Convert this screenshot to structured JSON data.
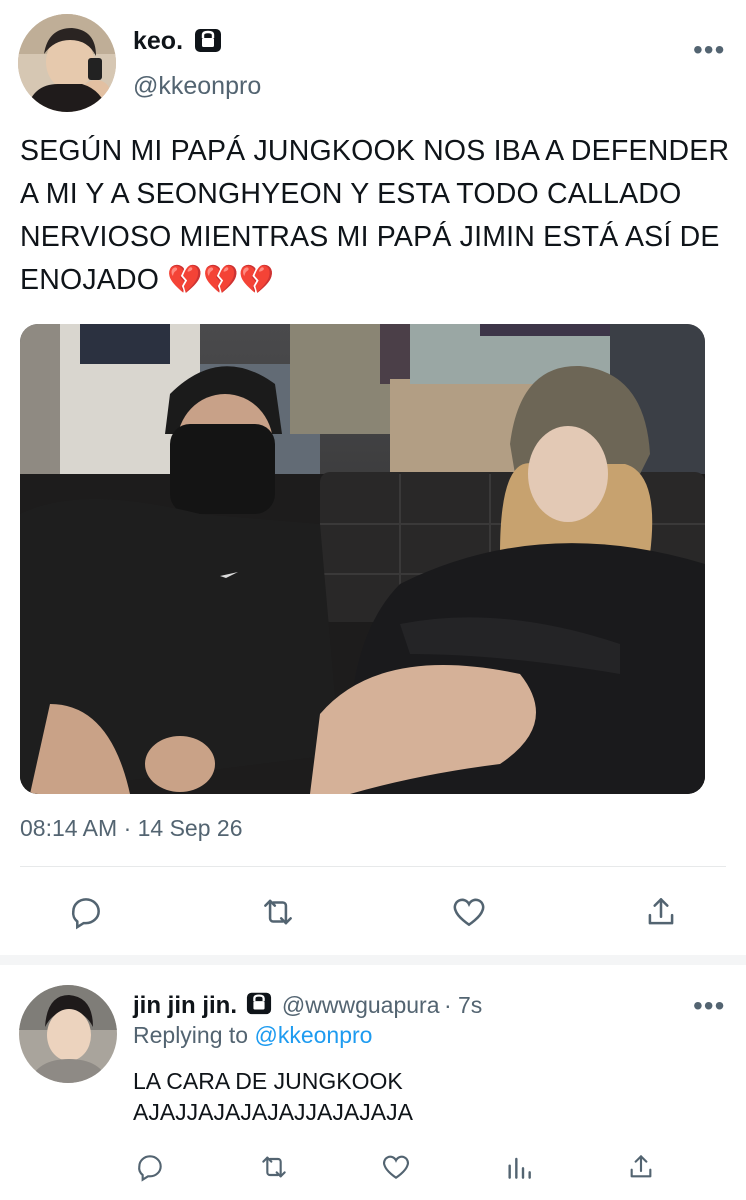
{
  "main_tweet": {
    "author_name": "keo.",
    "author_handle": "@kkeonpro",
    "text": "SEGÚN MI PAPÁ JUNGKOOK NOS IBA A DEFENDER A MI Y A SEONGHYEON Y ESTA TODO CALLADO NERVIOSO MIENTRAS MI PAPÁ JIMIN ESTÁ ASÍ DE ENOJADO 💔💔💔",
    "timestamp": "08:14 AM · 14 Sep 26",
    "more_label": "•••",
    "icons": [
      "reply-icon",
      "retweet-icon",
      "like-icon",
      "share-icon"
    ]
  },
  "reply_tweet": {
    "author_name": "jin jin jin.",
    "author_handle": "@wwwguapura",
    "time": "· 7s",
    "replying_prefix": "Replying to",
    "replying_handle": "@kkeonpro",
    "text_line1": "LA CARA DE JUNGKOOK",
    "text_line2": "AJAJJAJAJAJAJJAJAJAJA",
    "more_label": "•••",
    "icons": [
      "reply-icon",
      "retweet-icon",
      "like-icon",
      "views-icon",
      "share-icon"
    ]
  },
  "colors": {
    "text": "#0f1419",
    "secondary": "#536471",
    "accent": "#1d9bf0",
    "divider": "#e7e9ea"
  }
}
